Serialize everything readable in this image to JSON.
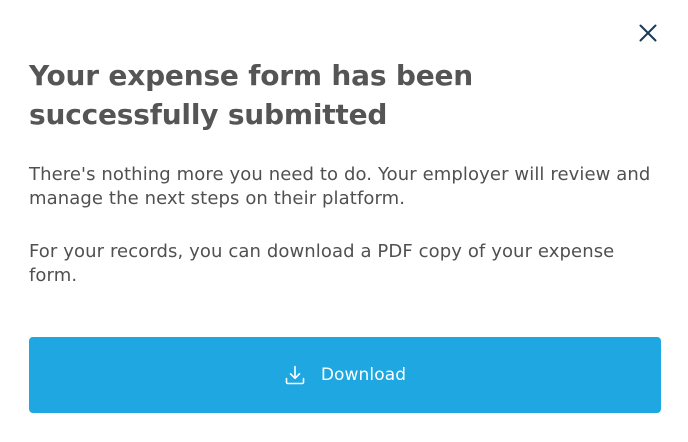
{
  "modal": {
    "close_icon": "close-icon",
    "title": "Your expense form has been successfully submitted",
    "paragraphs": [
      "There's nothing more you need to do. Your employer will review and manage the next steps on their platform.",
      "For your records, you can download a PDF copy of your expense form."
    ],
    "download_button": {
      "label": "Download",
      "icon": "download-icon"
    }
  },
  "colors": {
    "accent": "#1ea7e1",
    "title_text": "#555555",
    "body_text": "#505050",
    "close_icon": "#1b3a57"
  }
}
